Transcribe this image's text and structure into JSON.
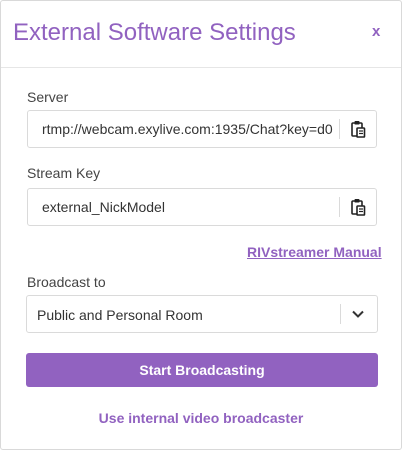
{
  "dialog": {
    "title": "External Software Settings",
    "close_label": "x"
  },
  "server": {
    "label": "Server",
    "value": "rtmp://webcam.exylive.com:1935/Chat?key=d0",
    "copy_icon": "clipboard-icon"
  },
  "stream_key": {
    "label": "Stream Key",
    "value": "external_NickModel",
    "copy_icon": "clipboard-icon"
  },
  "manual_link": "RIVstreamer Manual",
  "broadcast": {
    "label": "Broadcast to",
    "selected": "Public and Personal Room",
    "dropdown_icon": "chevron-down-icon"
  },
  "start_button": "Start Broadcasting",
  "internal_link": "Use internal video broadcaster",
  "colors": {
    "accent": "#9162c0",
    "border": "#dadada",
    "text": "#333333"
  }
}
